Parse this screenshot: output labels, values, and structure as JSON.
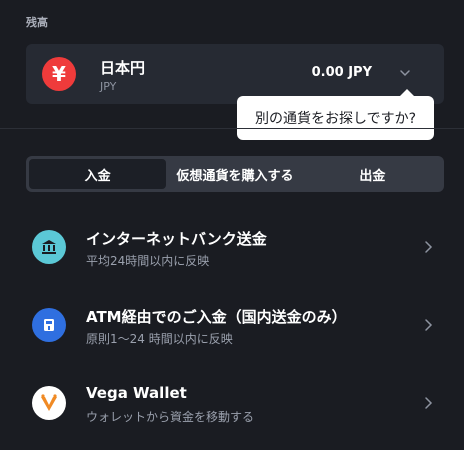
{
  "balance": {
    "label": "残高"
  },
  "currency": {
    "symbol": "¥",
    "name": "日本円",
    "code": "JPY",
    "amount": "0.00 JPY",
    "badge_color": "#ef3b3b"
  },
  "tooltip": {
    "text": "別の通貨をお探しですか?"
  },
  "tabs": [
    {
      "label": "入金",
      "active": true
    },
    {
      "label": "仮想通貨を購入する",
      "active": false
    },
    {
      "label": "出金",
      "active": false
    }
  ],
  "methods": [
    {
      "title": "インターネットバンク送金",
      "subtitle": "平均24時間以内に反映",
      "icon": "bank-icon",
      "icon_color": "#5bc8d6"
    },
    {
      "title": "ATM経由でのご入金（国内送金のみ）",
      "subtitle": "原則1～24 時間以内に反映",
      "icon": "atm-icon",
      "icon_color": "#2f6fe0"
    },
    {
      "title": "Vega Wallet",
      "subtitle": "ウォレットから資金を移動する",
      "icon": "vega-wallet-icon",
      "icon_color": "#ffffff"
    }
  ]
}
